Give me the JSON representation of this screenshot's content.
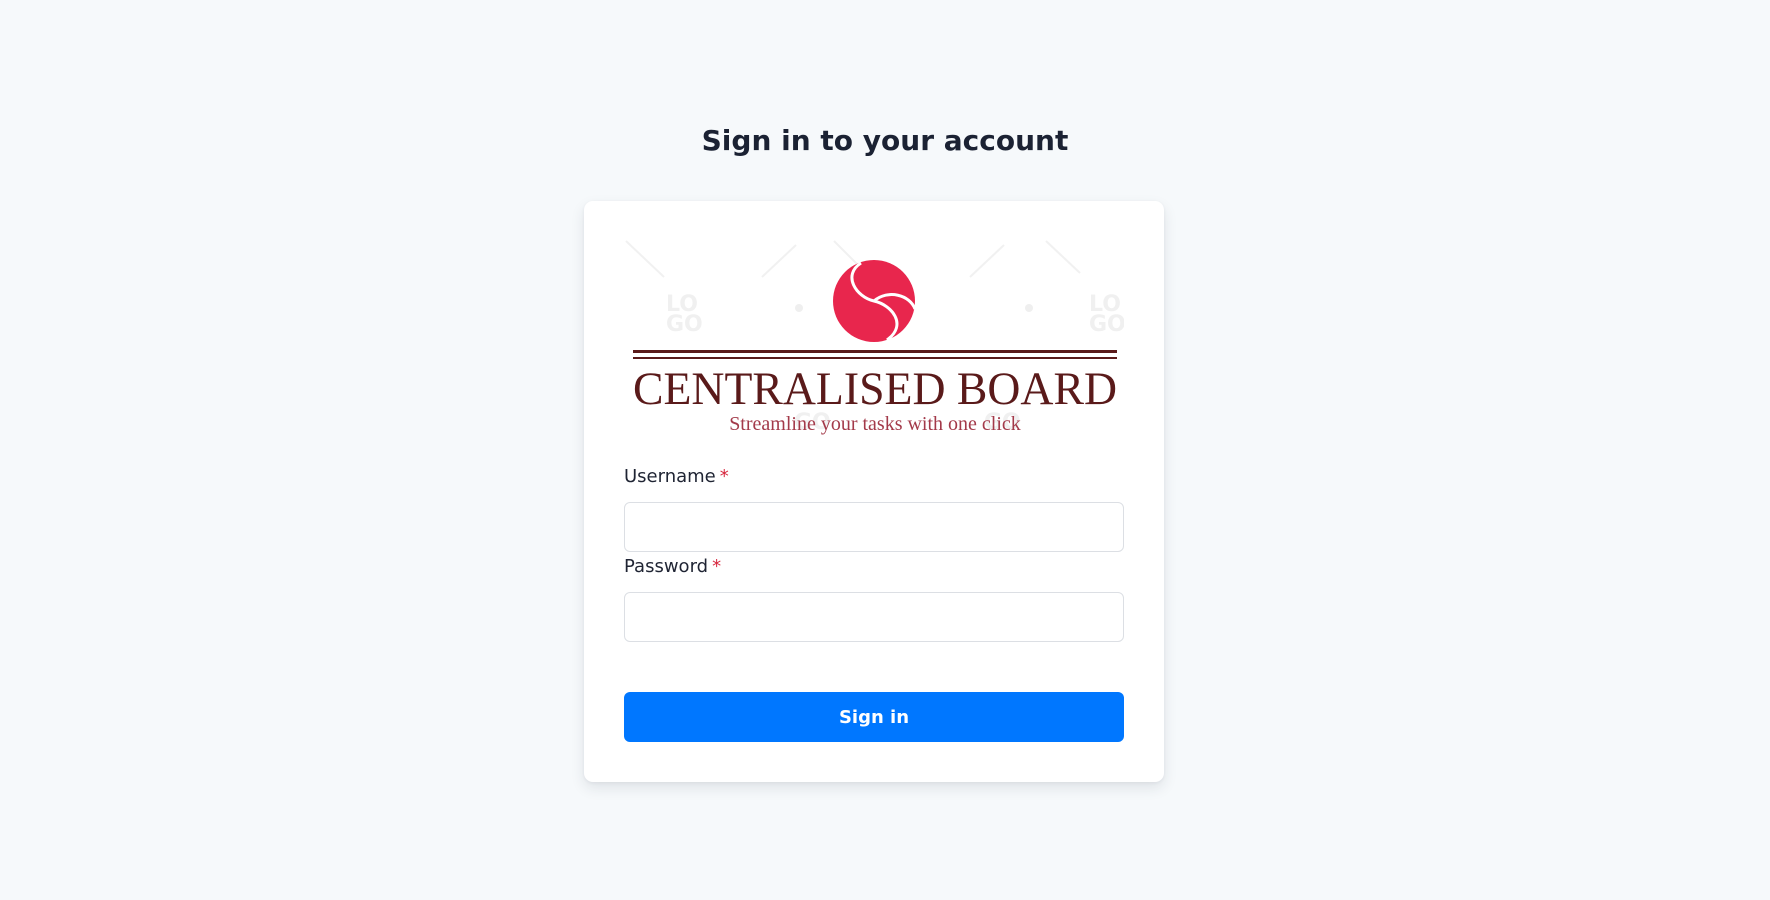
{
  "page": {
    "title": "Sign in to your account"
  },
  "logo": {
    "name": "CENTRALISED BOARD",
    "tagline": "Streamline your tasks with one click",
    "colors": {
      "mark": "#e8264d",
      "text": "#5a1a1a",
      "tagline": "#a33a4a"
    }
  },
  "form": {
    "username": {
      "label": "Username",
      "required_marker": "*",
      "value": ""
    },
    "password": {
      "label": "Password",
      "required_marker": "*",
      "value": ""
    },
    "submit_label": "Sign in"
  },
  "colors": {
    "background": "#f6f9fb",
    "card": "#ffffff",
    "accent": "#0077ff",
    "required": "#d7263d"
  }
}
